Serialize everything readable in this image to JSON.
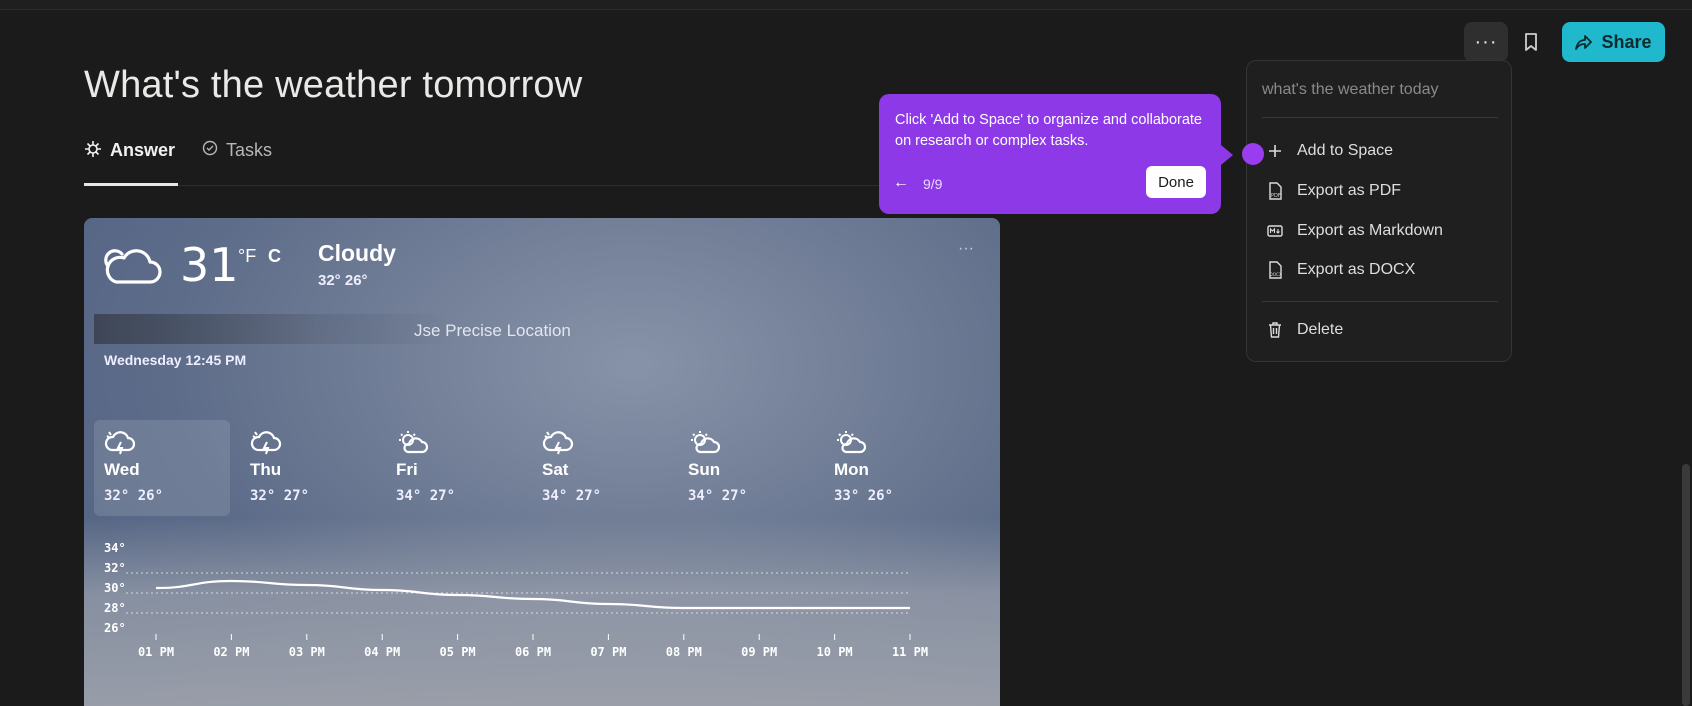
{
  "page": {
    "title": "What's the weather tomorrow"
  },
  "header": {
    "more_label": "···",
    "share_label": "Share"
  },
  "tabs": [
    {
      "label": "Answer",
      "active": true
    },
    {
      "label": "Tasks",
      "active": false
    }
  ],
  "weather": {
    "temperature": "31",
    "unit_f": "°F",
    "unit_c": "C",
    "condition": "Cloudy",
    "hilo": "32°  26°",
    "more": "···",
    "location_text": "Jse Precise Location",
    "datetime": "Wednesday 12:45 PM",
    "days": [
      {
        "name": "Wed",
        "temps": "32° 26°",
        "icon": "thunder-icon",
        "selected": true
      },
      {
        "name": "Thu",
        "temps": "32° 27°",
        "icon": "thunder-icon",
        "selected": false
      },
      {
        "name": "Fri",
        "temps": "34° 27°",
        "icon": "partly-cloudy-icon",
        "selected": false
      },
      {
        "name": "Sat",
        "temps": "34° 27°",
        "icon": "thunder-icon",
        "selected": false
      },
      {
        "name": "Sun",
        "temps": "34° 27°",
        "icon": "partly-cloudy-icon",
        "selected": false
      },
      {
        "name": "Mon",
        "temps": "33° 26°",
        "icon": "partly-cloudy-icon",
        "selected": false
      }
    ]
  },
  "chart_data": {
    "type": "line",
    "x": [
      "01 PM",
      "02 PM",
      "03 PM",
      "04 PM",
      "05 PM",
      "06 PM",
      "07 PM",
      "08 PM",
      "09 PM",
      "10 PM",
      "11 PM"
    ],
    "series": [
      {
        "values": [
          30.0,
          30.7,
          30.3,
          29.8,
          29.3,
          28.9,
          28.4,
          28.0,
          28.0,
          28.0,
          28.0
        ]
      }
    ],
    "y_ticks": [
      "34°",
      "32°",
      "30°",
      "28°",
      "26°"
    ],
    "y_tick_values": [
      34,
      32,
      30,
      28,
      26
    ],
    "ylim": [
      26,
      34
    ],
    "grid": true
  },
  "menu": {
    "search_text": "what's the weather today",
    "items": [
      {
        "label": "Add to Space",
        "icon": "plus-icon"
      },
      {
        "label": "Export as PDF",
        "icon": "pdf-file-icon"
      },
      {
        "label": "Export as Markdown",
        "icon": "markdown-icon"
      },
      {
        "label": "Export as DOCX",
        "icon": "docx-file-icon"
      },
      {
        "label": "Delete",
        "icon": "trash-icon"
      }
    ]
  },
  "tooltip": {
    "text": "Click 'Add to Space' to organize and collaborate on research or complex tasks.",
    "back": "←",
    "page": "9/9",
    "done": "Done"
  },
  "colors": {
    "accent": "#1fb8cd",
    "tooltip": "#8d39e8",
    "background": "#1b1b1b"
  }
}
